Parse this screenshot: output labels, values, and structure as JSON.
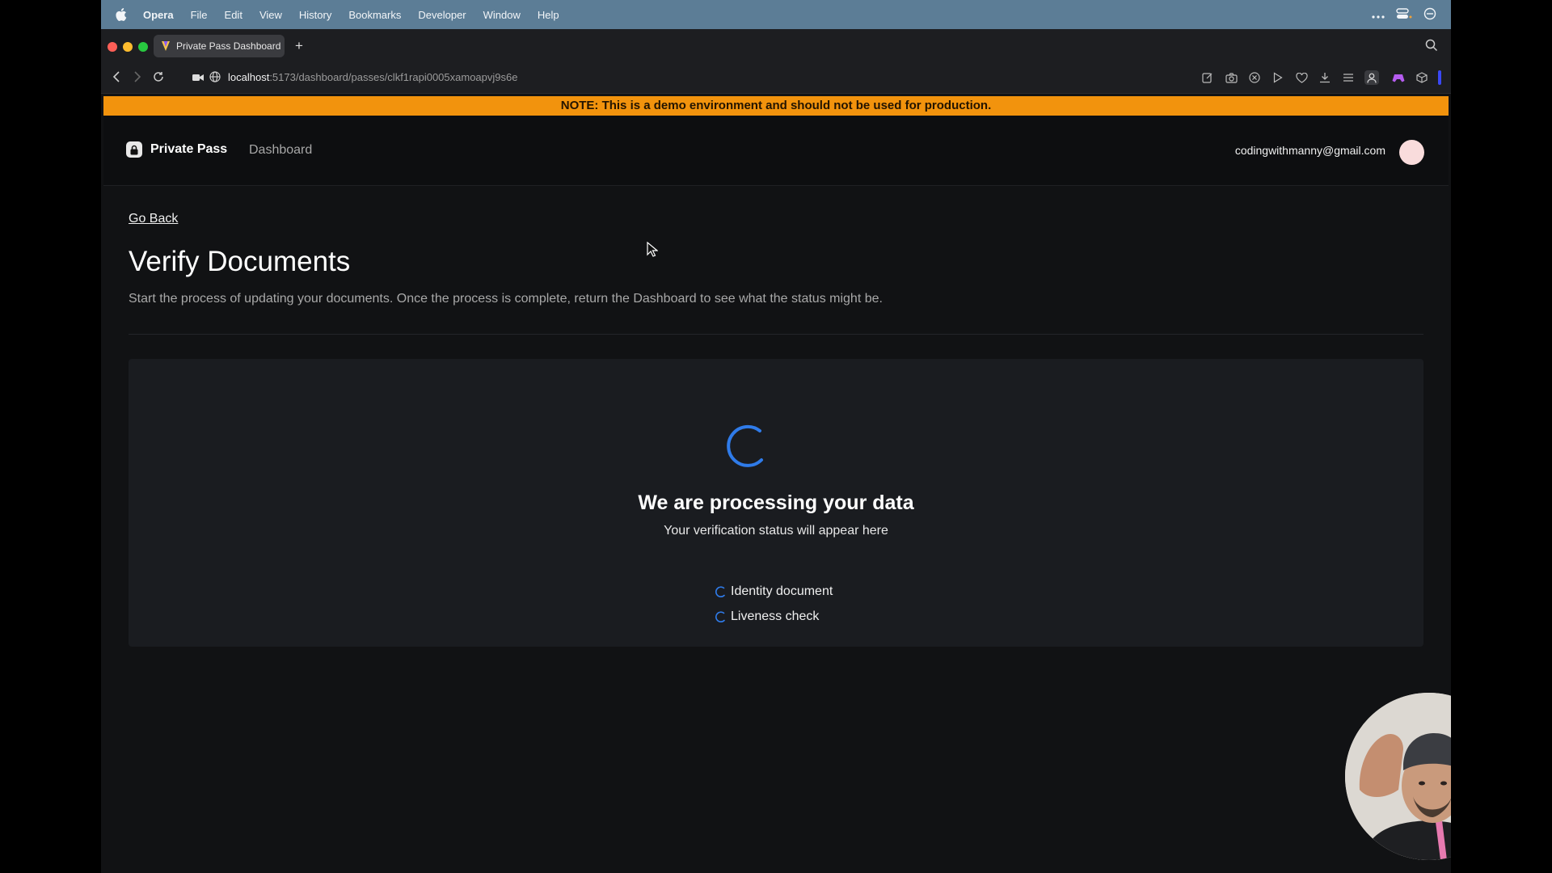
{
  "menubar": {
    "app_name": "Opera",
    "items": [
      "File",
      "Edit",
      "View",
      "History",
      "Bookmarks",
      "Developer",
      "Window",
      "Help"
    ]
  },
  "browser": {
    "tab_title": "Private Pass Dashboard",
    "url_host": "localhost",
    "url_path": ":5173/dashboard/passes/clkf1rapi0005xamoapvj9s6e"
  },
  "banner": {
    "text": "NOTE: This is a demo environment and should not be used for production."
  },
  "header": {
    "brand": "Private Pass",
    "nav_dashboard": "Dashboard",
    "user_email": "codingwithmanny@gmail.com"
  },
  "page": {
    "go_back": "Go Back",
    "title": "Verify Documents",
    "description": "Start the process of updating your documents. Once the process is complete, return the Dashboard to see what the status might be."
  },
  "processing": {
    "title": "We are processing your data",
    "subtitle": "Your verification status will appear here",
    "checks": [
      "Identity document",
      "Liveness check"
    ]
  },
  "colors": {
    "banner": "#f2930d",
    "accent_blue": "#2f7be9",
    "page_bg": "#111214",
    "card_bg": "#1a1c20"
  }
}
